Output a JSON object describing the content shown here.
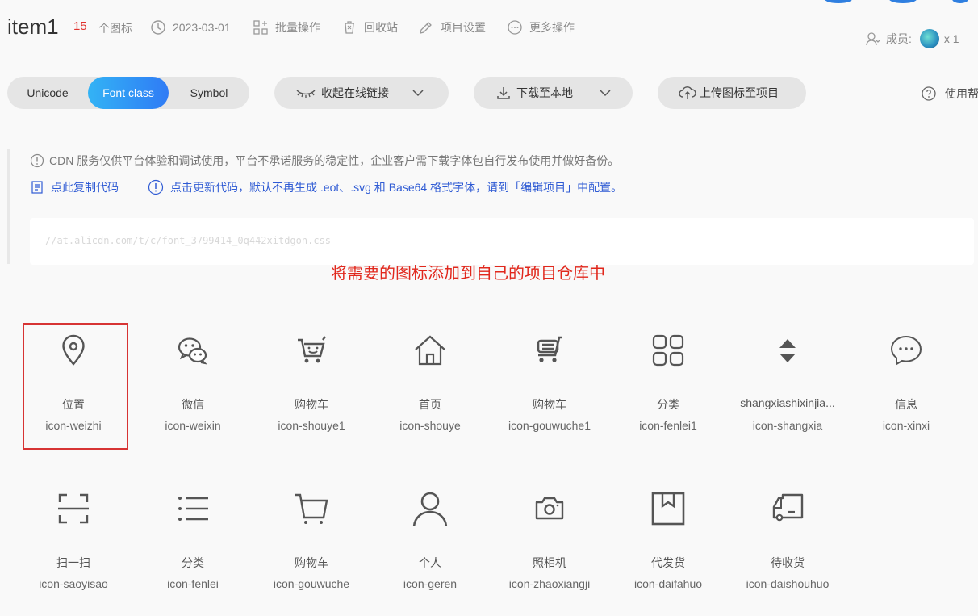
{
  "header": {
    "project_name": "item1",
    "icon_count": "15",
    "icon_count_label": "个图标",
    "date": "2023-03-01",
    "batch_ops": "批量操作",
    "recycle_bin": "回收站",
    "project_settings": "项目设置",
    "more_ops": "更多操作",
    "members_label": "成员:",
    "members_count": "x 1"
  },
  "toolbar": {
    "tabs": [
      "Unicode",
      "Font class",
      "Symbol"
    ],
    "active_tab": "Font class",
    "collapse_link": "收起在线链接",
    "download": "下载至本地",
    "upload": "上传图标至项目",
    "help": "使用帮"
  },
  "notice": {
    "cdn_warning": "CDN 服务仅供平台体验和调试使用，平台不承诺服务的稳定性，企业客户需下载字体包自行发布使用并做好备份。",
    "copy_code": "点此复制代码",
    "update_code": "点击更新代码，默认不再生成 .eot、.svg 和 Base64 格式字体，请到「编辑项目」中配置。",
    "css_url": "//at.alicdn.com/t/c/font_3799414_0q442xitdgon.css"
  },
  "annotation": "将需要的图标添加到自己的项目仓库中",
  "icons": [
    {
      "cn": "位置",
      "cls": "icon-weizhi",
      "icon": "location-icon"
    },
    {
      "cn": "微信",
      "cls": "icon-weixin",
      "icon": "wechat-icon"
    },
    {
      "cn": "购物车",
      "cls": "icon-shouye1",
      "icon": "cart-face-icon"
    },
    {
      "cn": "首页",
      "cls": "icon-shouye",
      "icon": "home-icon"
    },
    {
      "cn": "购物车",
      "cls": "icon-gouwuche1",
      "icon": "cart-lines-icon"
    },
    {
      "cn": "分类",
      "cls": "icon-fenlei1",
      "icon": "grid-icon"
    },
    {
      "cn": "shangxiashixinjia...",
      "cls": "icon-shangxia",
      "icon": "updown-icon"
    },
    {
      "cn": "信息",
      "cls": "icon-xinxi",
      "icon": "message-icon"
    },
    {
      "cn": "扫一扫",
      "cls": "icon-saoyisao",
      "icon": "scan-icon"
    },
    {
      "cn": "分类",
      "cls": "icon-fenlei",
      "icon": "list-icon"
    },
    {
      "cn": "购物车",
      "cls": "icon-gouwuche",
      "icon": "cart-icon"
    },
    {
      "cn": "个人",
      "cls": "icon-geren",
      "icon": "person-icon"
    },
    {
      "cn": "照相机",
      "cls": "icon-zhaoxiangji",
      "icon": "camera-icon"
    },
    {
      "cn": "代发货",
      "cls": "icon-daifahuo",
      "icon": "package-icon"
    },
    {
      "cn": "待收货",
      "cls": "icon-daishouhuo",
      "icon": "truck-icon"
    }
  ],
  "colors": {
    "accent_gradient_start": "#33b3f5",
    "accent_gradient_end": "#2f7bf5",
    "count_red": "#e0312d",
    "annotation_red": "#e1271c",
    "link_blue": "#2f5bd4"
  }
}
